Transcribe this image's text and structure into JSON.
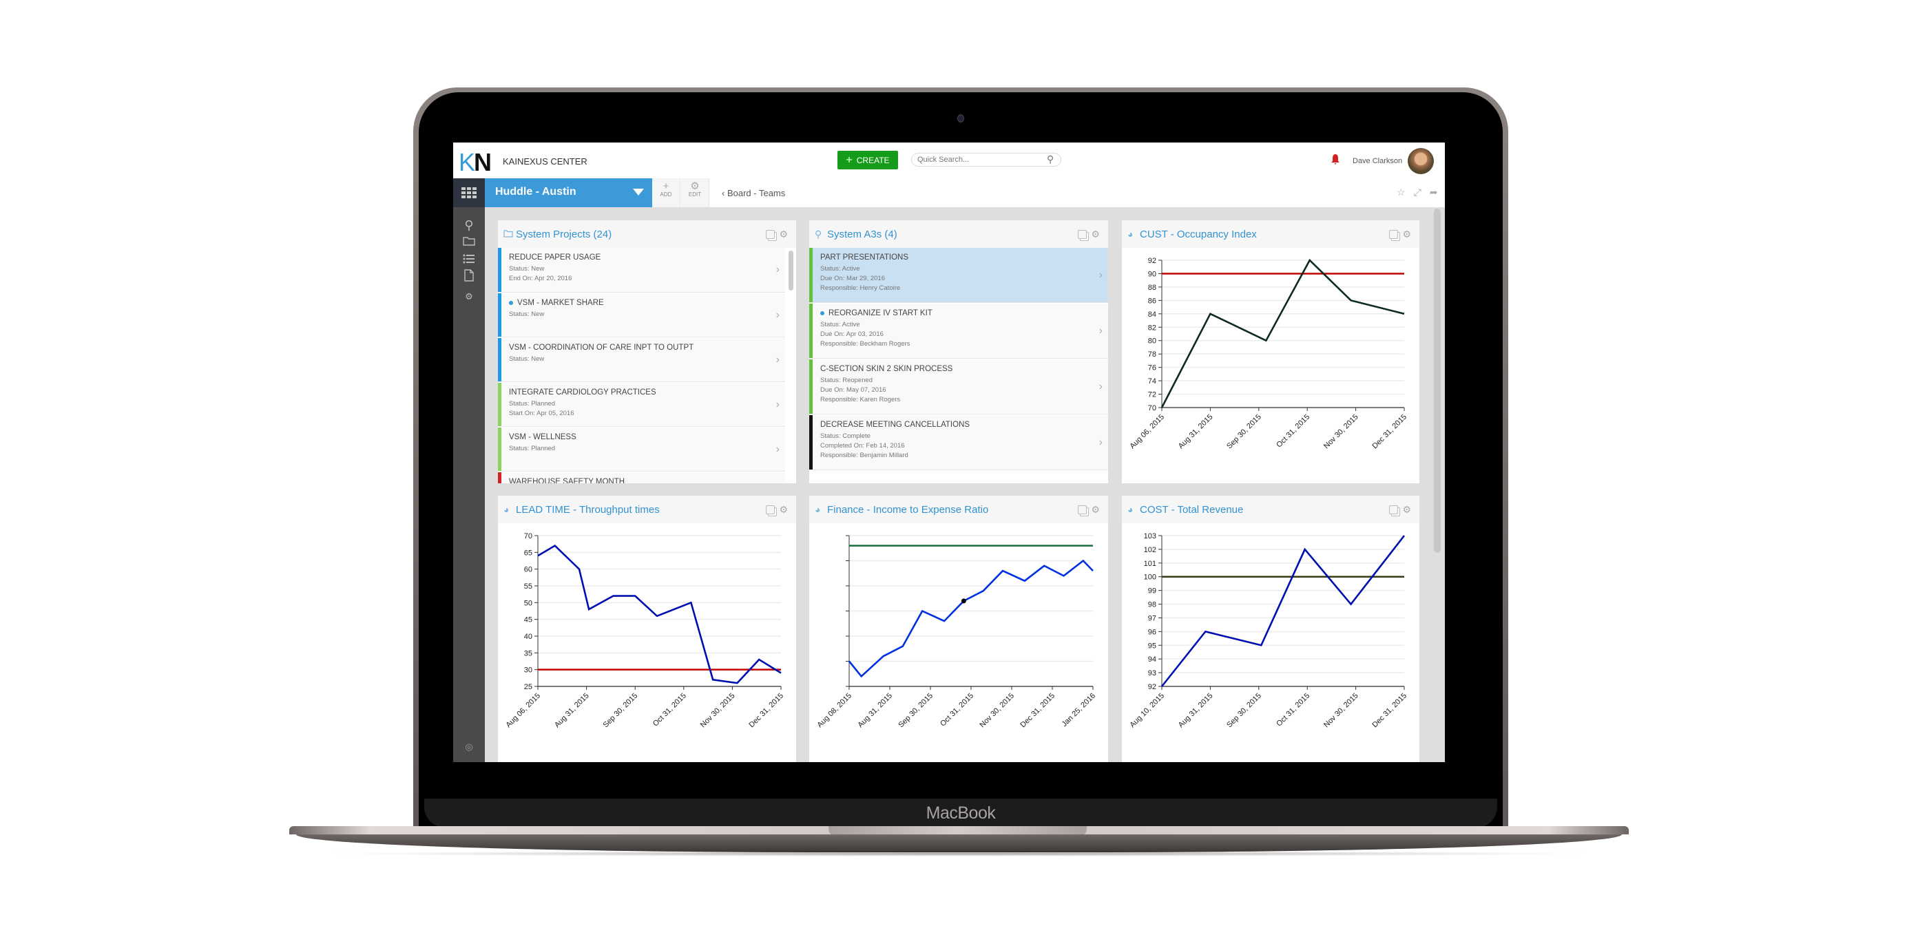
{
  "device": {
    "label": "MacBook"
  },
  "header": {
    "logo_k": "K",
    "logo_n": "N",
    "app_title": "KAINEXUS CENTER",
    "create_label": "CREATE",
    "search_placeholder": "Quick Search...",
    "user_name": "Dave Clarkson",
    "colors": {
      "brand": "#3d9ad8",
      "create": "#169c1b",
      "bell": "#d32020"
    }
  },
  "toolbar": {
    "board_select": "Huddle - Austin",
    "add_label": "ADD",
    "edit_label": "EDIT",
    "breadcrumb": "Board - Teams",
    "icons": [
      "star-icon",
      "expand-icon",
      "share-icon"
    ]
  },
  "sidebar": {
    "icons": [
      "apps-grid-icon",
      "lightbulb-icon",
      "folder-icon",
      "list-icon",
      "document-icon",
      "gear-icon",
      "collapse-icon"
    ]
  },
  "cards": {
    "projects": {
      "title": "System Projects (24)",
      "icon": "folder-icon",
      "items": [
        {
          "title": "REDUCE PAPER USAGE",
          "lines": [
            "Status: New",
            "End On: Apr 20, 2016"
          ],
          "color": "#1a9be8",
          "dot": false
        },
        {
          "title": "VSM - MARKET SHARE",
          "lines": [
            "Status: New"
          ],
          "color": "#1a9be8",
          "dot": true
        },
        {
          "title": "VSM - COORDINATION OF CARE INPT TO OUTPT",
          "lines": [
            "Status: New"
          ],
          "color": "#1a9be8",
          "dot": false
        },
        {
          "title": "INTEGRATE CARDIOLOGY PRACTICES",
          "lines": [
            "Status: Planned",
            "Start On: Apr 05, 2016"
          ],
          "color": "#8ad45a",
          "dot": false
        },
        {
          "title": "VSM - WELLNESS",
          "lines": [
            "Status: Planned"
          ],
          "color": "#8ad45a",
          "dot": false
        },
        {
          "title": "WAREHOUSE SAFETY MONTH",
          "lines": [],
          "color": "#d42020",
          "dot": false
        }
      ]
    },
    "a3s": {
      "title": "System A3s (4)",
      "icon": "lightbulb-icon",
      "items": [
        {
          "title": "PART PRESENTATIONS",
          "lines": [
            "Status: Active",
            "Due On: Mar 29, 2016",
            "Responsible: Henry Catoire"
          ],
          "color": "#63c13b",
          "dot": false,
          "selected": true
        },
        {
          "title": "REORGANIZE IV START KIT",
          "lines": [
            "Status: Active",
            "Due On: Apr 03, 2016",
            "Responsible: Beckham Rogers"
          ],
          "color": "#63c13b",
          "dot": true
        },
        {
          "title": "C-SECTION SKIN 2 SKIN PROCESS",
          "lines": [
            "Status: Reopened",
            "Due On: May 07, 2016",
            "Responsible: Karen Rogers"
          ],
          "color": "#63c13b",
          "dot": false
        },
        {
          "title": "DECREASE MEETING CANCELLATIONS",
          "lines": [
            "Status: Complete",
            "Completed On: Feb 14, 2016",
            "Responsible: Benjamin Millard"
          ],
          "color": "#111111",
          "dot": false
        }
      ]
    }
  },
  "chart_data": [
    {
      "id": "occupancy",
      "type": "line",
      "title": "CUST - Occupancy Index",
      "xlabel": "",
      "ylabel": "",
      "ylim": [
        70,
        92
      ],
      "yticks": [
        70,
        72,
        74,
        76,
        78,
        80,
        82,
        84,
        86,
        88,
        90,
        92
      ],
      "xtick_labels": [
        "Aug 06, 2015",
        "Aug 31, 2015",
        "Sep 30, 2015",
        "Oct 31, 2015",
        "Nov 30, 2015",
        "Dec 31, 2015"
      ],
      "grid": true,
      "series": [
        {
          "name": "Occupancy Index",
          "color": "#0b2a24",
          "values": [
            70,
            84,
            80,
            92,
            86,
            84
          ],
          "x_pos": [
            0,
            0.2,
            0.43,
            0.61,
            0.78,
            1.0
          ]
        }
      ],
      "target": {
        "value": 90,
        "color": "#c40000"
      }
    },
    {
      "id": "leadtime",
      "type": "line",
      "title": "LEAD TIME - Throughput times",
      "xlabel": "",
      "ylabel": "",
      "ylim": [
        25,
        70
      ],
      "yticks": [
        25,
        30,
        35,
        40,
        45,
        50,
        55,
        60,
        65,
        70
      ],
      "xtick_labels": [
        "Aug 06, 2015",
        "Aug 31, 2015",
        "Sep 30, 2015",
        "Oct 31, 2015",
        "Nov 30, 2015",
        "Dec 31, 2015"
      ],
      "grid": true,
      "series": [
        {
          "name": "Throughput time",
          "color": "#0010b0",
          "values": [
            64,
            67,
            60,
            48,
            52,
            52,
            46,
            50,
            27,
            26,
            33,
            29
          ],
          "x_pos": [
            0,
            0.07,
            0.17,
            0.21,
            0.31,
            0.4,
            0.49,
            0.63,
            0.72,
            0.82,
            0.91,
            1.0
          ]
        }
      ],
      "target": {
        "value": 30,
        "color": "#c40000"
      }
    },
    {
      "id": "finance",
      "type": "line",
      "title": "Finance - Income to Expense Ratio",
      "xlabel": "",
      "ylabel": "",
      "ylim": [
        0,
        6
      ],
      "yticks": [
        0,
        1,
        2,
        3,
        4,
        5,
        6
      ],
      "ytick_labels_visible": false,
      "xtick_labels": [
        "Aug 08, 2015",
        "Aug 31, 2015",
        "Sep 30, 2015",
        "Oct 31, 2015",
        "Nov 30, 2015",
        "Dec 31, 2015",
        "Jan 25, 2016"
      ],
      "grid": true,
      "series": [
        {
          "name": "Income to Expense Ratio",
          "color": "#0030e0",
          "values": [
            1.0,
            0.4,
            1.2,
            1.6,
            3.0,
            2.6,
            3.4,
            3.8,
            4.6,
            4.2,
            4.8,
            4.4,
            5.0,
            4.6
          ],
          "x_pos": [
            0,
            0.05,
            0.14,
            0.22,
            0.3,
            0.39,
            0.47,
            0.55,
            0.63,
            0.72,
            0.8,
            0.88,
            0.96,
            1.0
          ],
          "highlight_index": 6
        }
      ],
      "target": {
        "value": 5.6,
        "color": "#1a6a3a"
      }
    },
    {
      "id": "revenue",
      "type": "line",
      "title": "COST - Total Revenue",
      "xlabel": "",
      "ylabel": "",
      "ylim": [
        92,
        103
      ],
      "yticks": [
        92,
        93,
        94,
        95,
        96,
        97,
        98,
        99,
        100,
        101,
        102,
        103
      ],
      "xtick_labels": [
        "Aug 10, 2015",
        "Aug 31, 2015",
        "Sep 30, 2015",
        "Oct 31, 2015",
        "Nov 30, 2015",
        "Dec 31, 2015"
      ],
      "grid": true,
      "series": [
        {
          "name": "Total Revenue",
          "color": "#0010b0",
          "values": [
            92,
            96,
            95,
            102,
            98,
            103
          ],
          "x_pos": [
            0,
            0.18,
            0.41,
            0.59,
            0.78,
            1.0
          ]
        }
      ],
      "target": {
        "value": 100,
        "color": "#3a3a10"
      }
    }
  ]
}
